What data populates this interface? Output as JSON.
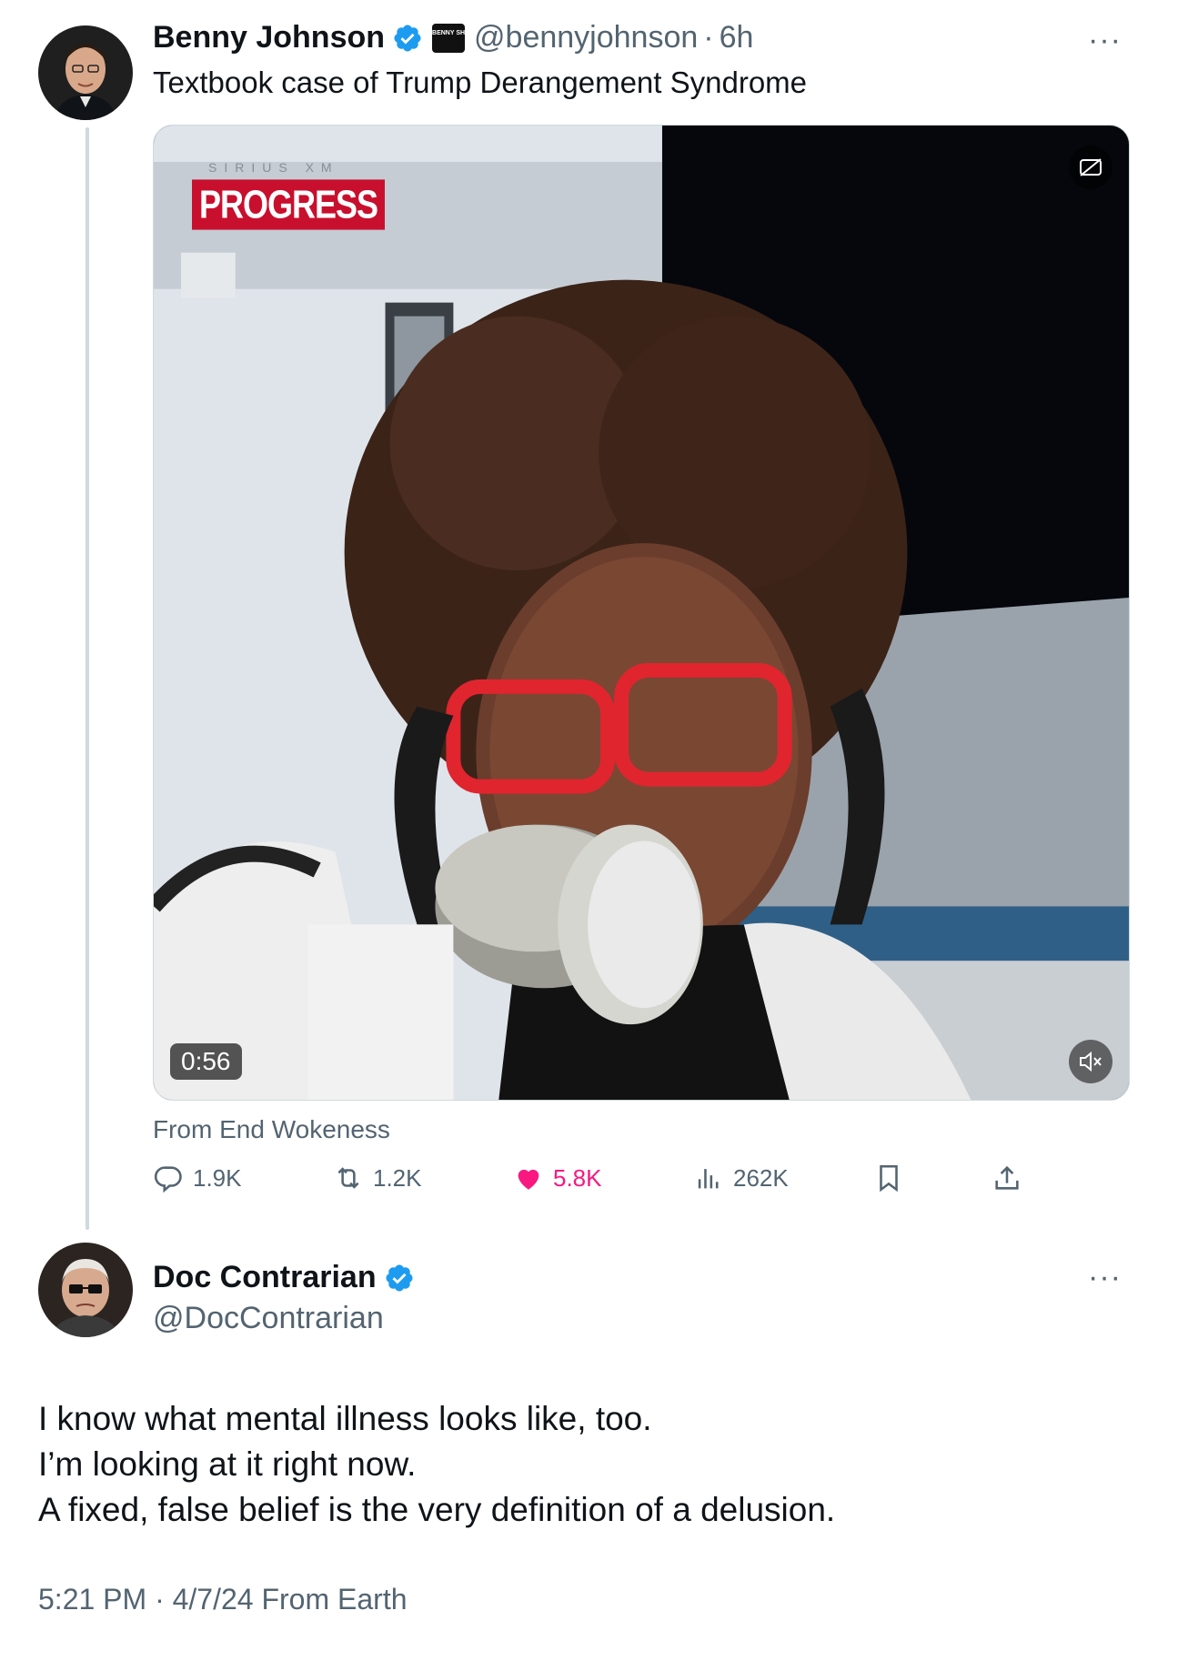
{
  "tweet1": {
    "name": "Benny Johnson",
    "affiliate_badge": "BENNY SHOW",
    "handle": "@bennyjohnson",
    "separator": "·",
    "time": "6h",
    "text": "Textbook case of Trump Derangement Syndrome",
    "video": {
      "duration": "0:56",
      "overlay_logo": "PROGRESS",
      "overlay_network": "SIRIUS XM"
    },
    "source": "From End Wokeness",
    "actions": {
      "replies": "1.9K",
      "reposts": "1.2K",
      "likes": "5.8K",
      "views": "262K"
    }
  },
  "tweet2": {
    "name": "Doc Contrarian",
    "handle": "@DocContrarian",
    "body_lines": [
      "I know what mental illness looks like, too.",
      "I’m looking at it right now.",
      "A fixed, false belief is the very definition of a delusion."
    ],
    "meta": "5:21 PM · 4/7/24 From Earth"
  },
  "more_label": "···",
  "colors": {
    "verified": "#1d9bf0",
    "like": "#f91880",
    "secondary_text": "#536471",
    "border": "#cfd9de"
  },
  "icons": [
    "verified-badge-icon",
    "reply-icon",
    "repost-icon",
    "heart-icon",
    "views-icon",
    "bookmark-icon",
    "share-icon",
    "mute-icon",
    "captions-icon",
    "more-icon"
  ]
}
